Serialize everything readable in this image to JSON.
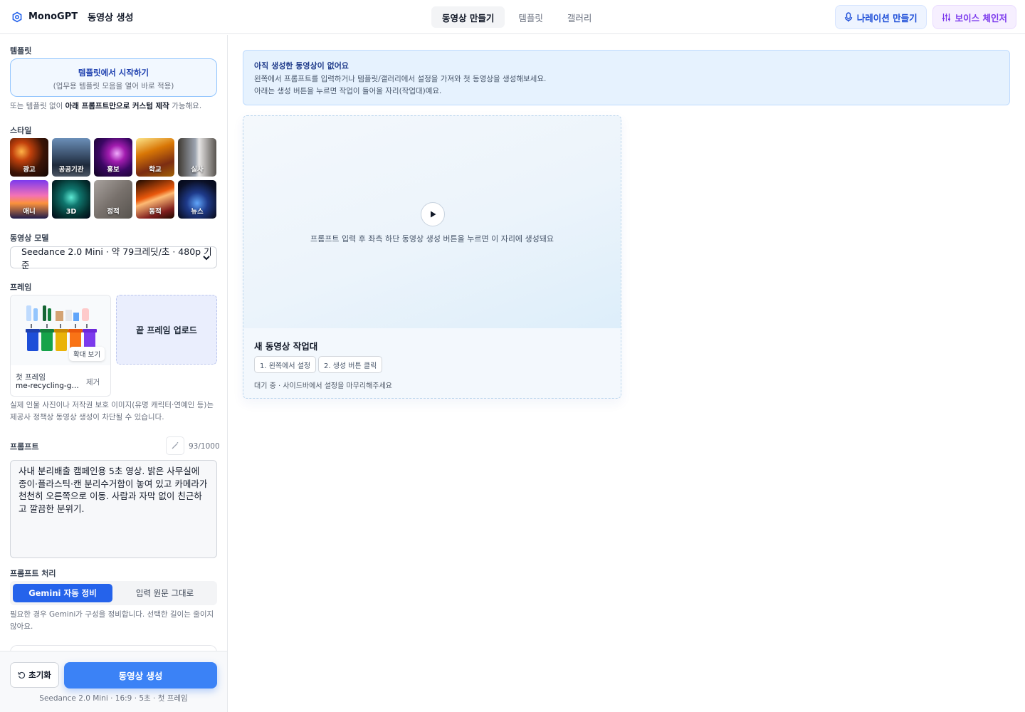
{
  "header": {
    "brand": "MonoGPT",
    "page": "동영상 생성",
    "tabs": [
      {
        "label": "동영상 만들기",
        "active": true
      },
      {
        "label": "템플릿",
        "active": false
      },
      {
        "label": "갤러리",
        "active": false
      }
    ],
    "narration_button": "나레이션 만들기",
    "voice_button": "보이스 체인저"
  },
  "sidebar": {
    "template_label": "템플릿",
    "template_button_title": "템플릿에서 시작하기",
    "template_button_sub": "(업무용 템플릿 모음을 열어 바로 적용)",
    "template_hint_pre": "또는 템플릿 없이 ",
    "template_hint_bold": "아래 프롬프트만으로 커스텀 제작",
    "template_hint_post": " 가능해요.",
    "style_label": "스타일",
    "styles": [
      "광고",
      "공공기관",
      "홍보",
      "학교",
      "실사",
      "애니",
      "3D",
      "정적",
      "동적",
      "뉴스"
    ],
    "model_label": "동영상 모델",
    "model_value": "Seedance 2.0 Mini · 약 79크레딧/초 · 480p 기준",
    "frame_label": "프레임",
    "first_frame_label": "첫 프레임",
    "first_frame_file": "me-recycling-guide.png",
    "zoom_label": "확대 보기",
    "remove_label": "제거",
    "end_frame_upload": "끝 프레임 업로드",
    "frame_warning": "실제 인물 사진이나 저작권 보호 이미지(유명 캐릭터·연예인 등)는 제공사 정책상 동영상 생성이 차단될 수 있습니다.",
    "prompt_label": "프롬프트",
    "prompt_count": "93/1000",
    "prompt_text": "사내 분리배출 캠페인용 5초 영상. 밝은 사무실에 종이·플라스틱·캔 분리수거함이 놓여 있고 카메라가 천천히 오른쪽으로 이동. 사람과 자막 없이 친근하고 깔끔한 분위기.",
    "processing_label": "프롬프트 처리",
    "processing_on": "Gemini 자동 정비",
    "processing_off": "입력 원문 그대로",
    "processing_hint": "필요한 경우 Gemini가 구성을 정비합니다. 선택한 길이는 줄이지 않아요.",
    "reset_button": "초기화",
    "generate_button": "동영상 생성",
    "footer_info": "Seedance 2.0 Mini · 16:9 · 5초 · 첫 프레임"
  },
  "main": {
    "notice_title": "아직 생성한 동영상이 없어요",
    "notice_line1": "왼쪽에서 프롬프트를 입력하거나 템플릿/갤러리에서 설정을 가져와 첫 동영상을 생성해보세요.",
    "notice_line2": "아래는 생성 버튼을 누르면 작업이 들어올 자리(작업대)예요.",
    "preview_text": "프롬프트 입력 후 좌측 하단 동영상 생성 버튼을 누르면 이 자리에 생성돼요",
    "card_title": "새 동영상 작업대",
    "chip1": "1. 왼쪽에서 설정",
    "chip2": "2. 생성 버튼 클릭",
    "card_status": "대기 중 · 사이드바에서 설정을 마무리해주세요"
  },
  "colors": {
    "accent": "#3b82f6",
    "accent_dark": "#2563eb",
    "notice_bg": "#e6f2fe",
    "voice": "#7c3aed"
  }
}
